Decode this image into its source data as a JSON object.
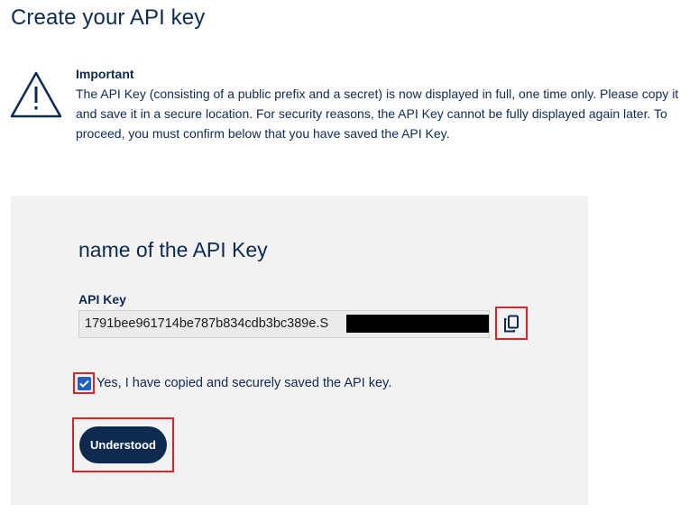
{
  "page": {
    "title": "Create your API key"
  },
  "notice": {
    "icon": "warning-triangle-icon",
    "heading": "Important",
    "body": "The API Key (consisting of a public prefix and a secret) is now displayed in full, one time only. Please copy it and save it in a secure location. For security reasons, the API Key cannot be fully displayed again later. To proceed, you must confirm below that you have saved the API Key."
  },
  "card": {
    "key_name": "name of the API Key",
    "api_key_label": "API Key",
    "api_key_value": "1791bee961714be787b834cdb3bc389e.S",
    "copy_icon": "copy-icon",
    "confirm_label": "Yes, I have copied and securely saved the API key.",
    "confirm_checked": true,
    "understood_label": "Understood"
  },
  "colors": {
    "primary": "#0f2a4f",
    "highlight": "#e01f26",
    "checkbox": "#1d63c4",
    "card_bg": "#f2f2f2"
  }
}
